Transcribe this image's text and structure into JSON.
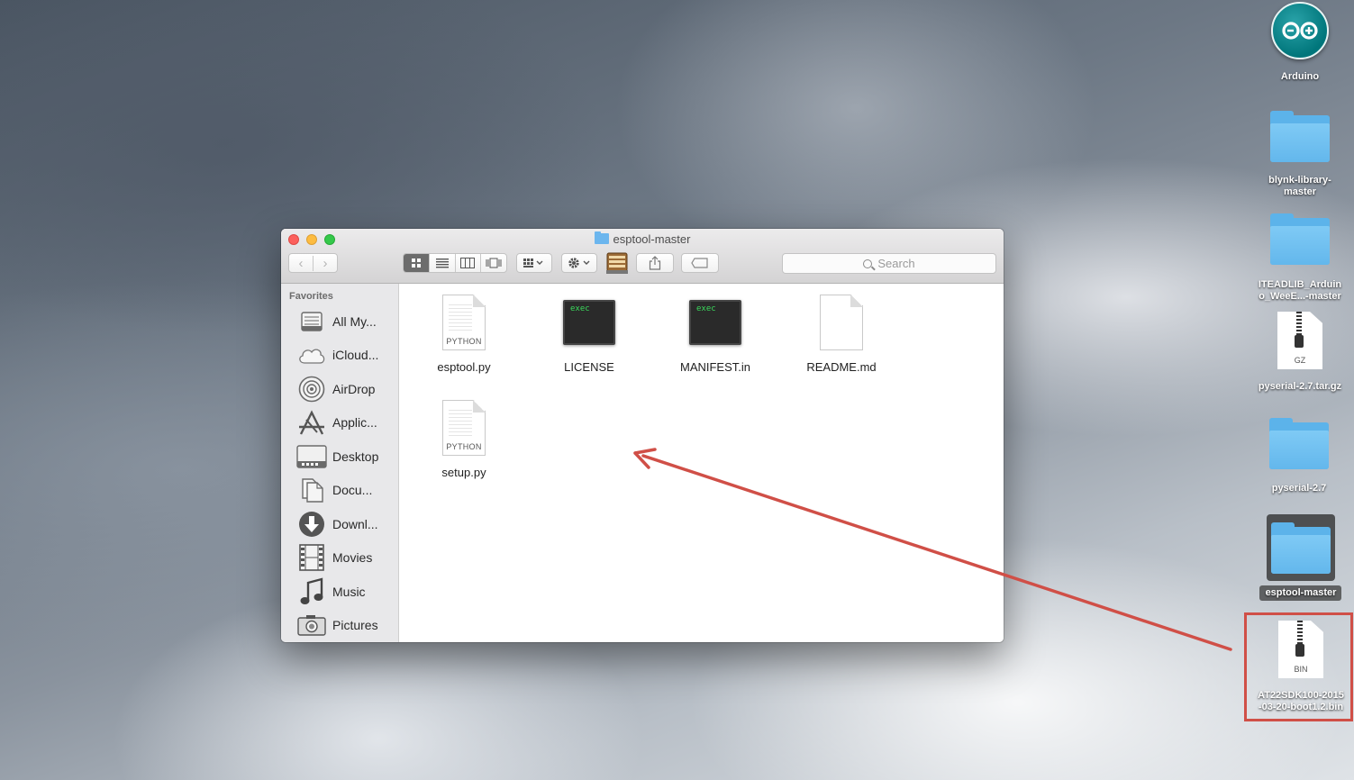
{
  "window": {
    "title": "esptool-master",
    "search_placeholder": "Search",
    "nav_back": "‹",
    "nav_forward": "›"
  },
  "sidebar": {
    "heading": "Favorites",
    "items": [
      {
        "label": "All My...",
        "icon": "all-my-files-icon"
      },
      {
        "label": "iCloud...",
        "icon": "icloud-icon"
      },
      {
        "label": "AirDrop",
        "icon": "airdrop-icon"
      },
      {
        "label": "Applic...",
        "icon": "applications-icon"
      },
      {
        "label": "Desktop",
        "icon": "desktop-icon"
      },
      {
        "label": "Docu...",
        "icon": "documents-icon"
      },
      {
        "label": "Downl...",
        "icon": "downloads-icon"
      },
      {
        "label": "Movies",
        "icon": "movies-icon"
      },
      {
        "label": "Music",
        "icon": "music-icon"
      },
      {
        "label": "Pictures",
        "icon": "pictures-icon"
      }
    ]
  },
  "files": [
    {
      "name": "esptool.py",
      "type": "python",
      "tag": "PYTHON"
    },
    {
      "name": "LICENSE",
      "type": "exec",
      "tag": "exec"
    },
    {
      "name": "MANIFEST.in",
      "type": "exec",
      "tag": "exec"
    },
    {
      "name": "README.md",
      "type": "blank",
      "tag": ""
    },
    {
      "name": "setup.py",
      "type": "python",
      "tag": "PYTHON"
    }
  ],
  "desktop": [
    {
      "label": "Arduino",
      "type": "app"
    },
    {
      "label_line1": "blynk-library-",
      "label_line2": "master",
      "type": "folder"
    },
    {
      "label_line1": "ITEADLIB_Arduin",
      "label_line2": "o_WeeE...-master",
      "type": "folder"
    },
    {
      "label": "pyserial-2.7.tar.gz",
      "type": "archive",
      "tag": "GZ"
    },
    {
      "label": "pyserial-2.7",
      "type": "folder"
    },
    {
      "label": "esptool-master",
      "type": "folder",
      "selected": true
    },
    {
      "label_line1": "AT22SDK100-2015",
      "label_line2": "-03-20-boot1.2.bin",
      "type": "archive",
      "tag": "BIN"
    }
  ],
  "colors": {
    "annotation_red": "#d04f47",
    "folder_blue": "#5cb3ea",
    "arduino_teal": "#00767b"
  }
}
